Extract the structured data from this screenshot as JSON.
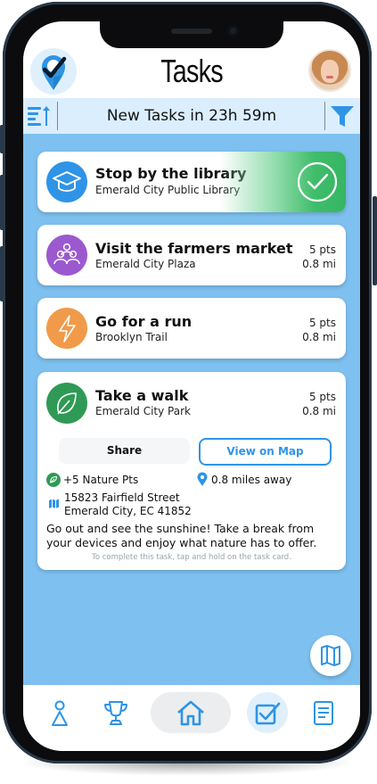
{
  "header": {
    "title": "Tasks",
    "logo_icon": "location-check-pin-icon",
    "avatar_icon": "user-avatar"
  },
  "subbar": {
    "sort_icon": "sort-icon",
    "text": "New Tasks in 23h 59m",
    "filter_icon": "filter-icon"
  },
  "tasks": [
    {
      "name": "Stop by the library",
      "location": "Emerald City Public Library",
      "icon": "graduation-cap-icon",
      "icon_color": "#2f94e6",
      "completed": true,
      "status_icon": "check-circle-icon"
    },
    {
      "name": "Visit the farmers market",
      "location": "Emerald City Plaza",
      "points": "5 pts",
      "distance": "0.8 mi",
      "icon": "people-group-icon",
      "icon_color": "#9b59d0"
    },
    {
      "name": "Go for a run",
      "location": "Brooklyn Trail",
      "points": "5 pts",
      "distance": "0.8 mi",
      "icon": "lightning-bolt-icon",
      "icon_color": "#f09a4a"
    },
    {
      "name": "Take a walk",
      "location": "Emerald City Park",
      "points": "5 pts",
      "distance": "0.8 mi",
      "icon": "leaf-icon",
      "icon_color": "#2f9a55",
      "expanded": true,
      "share_label": "Share",
      "map_label": "View on Map",
      "nature_pts": "+5 Nature Pts",
      "miles_away": "0.8 miles away",
      "address_line1": "15823 Fairfield Street",
      "address_line2": "Emerald City, EC 41852",
      "description": "Go out and see the sunshine! Take a break from your devices and enjoy what nature has to offer.",
      "hint": "To complete this task, tap and hold on the task card."
    }
  ],
  "fab": {
    "icon": "map-icon"
  },
  "nav": {
    "items": [
      {
        "icon": "person-icon"
      },
      {
        "icon": "trophy-icon"
      },
      {
        "icon": "home-icon",
        "active": true
      },
      {
        "icon": "checkbox-icon",
        "selected": true
      },
      {
        "icon": "document-icon"
      }
    ]
  },
  "colors": {
    "background": "#7ec0ef",
    "accent": "#2f94e6",
    "subbar": "#daeefd",
    "done_green": "#36b563"
  }
}
